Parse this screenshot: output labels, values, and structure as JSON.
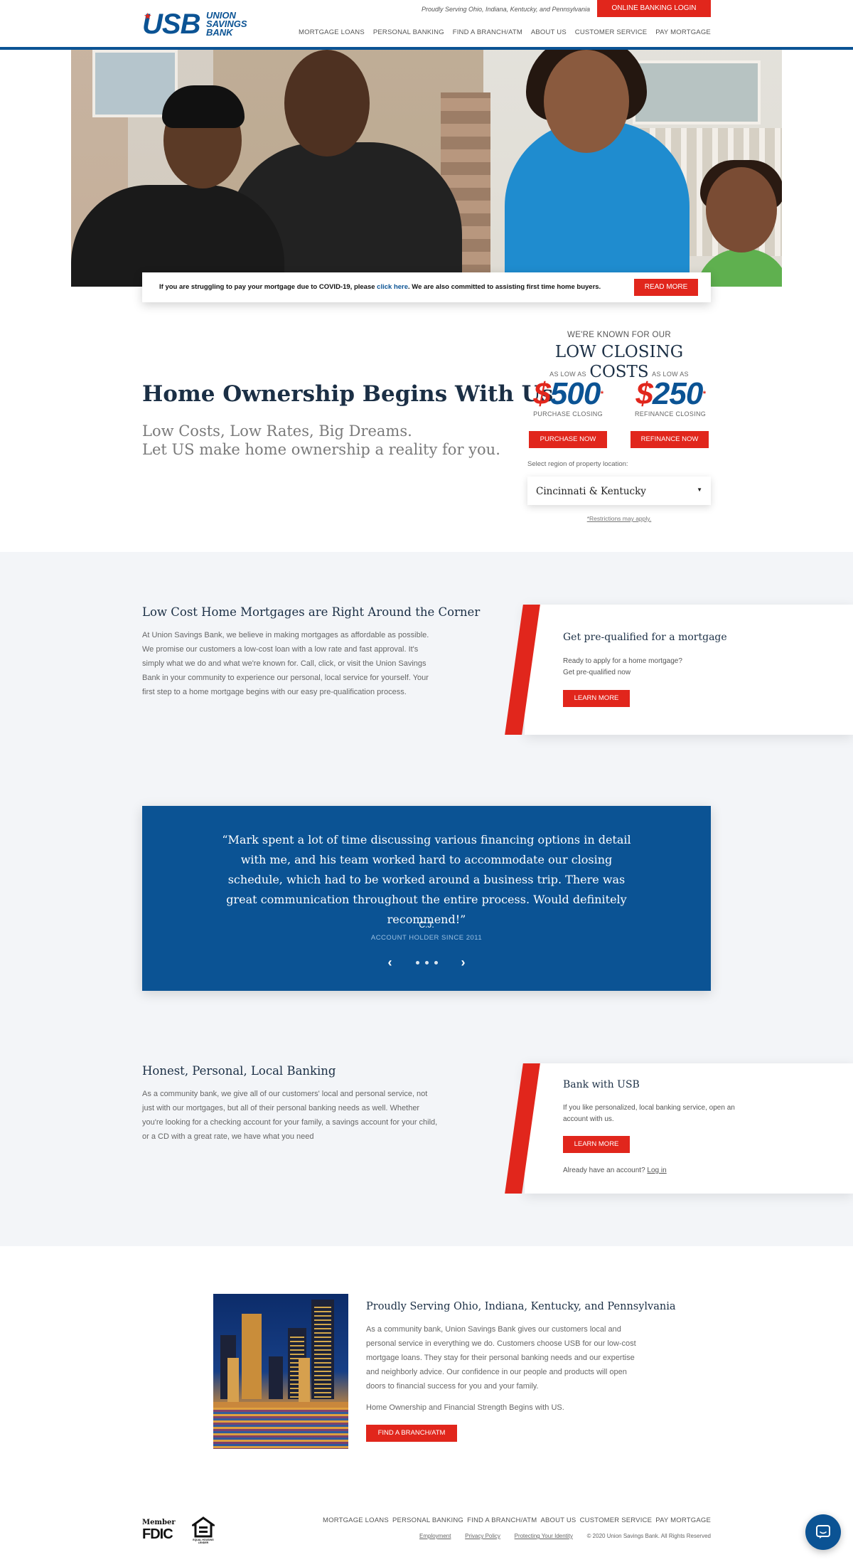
{
  "header": {
    "logo_mark": "USB",
    "logo_name": "UNION SAVINGS BANK",
    "proud_line": "Proudly Serving Ohio, Indiana, Kentucky, and Pennsylvania",
    "login_label": "ONLINE BANKING LOGIN",
    "nav": [
      "MORTGAGE LOANS",
      "PERSONAL BANKING",
      "FIND A BRANCH/ATM",
      "ABOUT US",
      "CUSTOMER SERVICE",
      "PAY MORTGAGE"
    ]
  },
  "covid": {
    "text_before": "If you are struggling to pay your mortgage due to COVID-19, please ",
    "link": "click here",
    "text_after": ". We are also committed to assisting first time home buyers.",
    "button": "READ MORE"
  },
  "intro": {
    "title": "Home Ownership Begins With Us",
    "sub_line1": "Low Costs, Low Rates, Big Dreams.",
    "sub_line2": "Let US make home ownership a reality for you."
  },
  "closing": {
    "known": "WE'RE KNOWN FOR OUR",
    "title": "LOW CLOSING COSTS",
    "purchase": {
      "as_low": "AS LOW AS",
      "dollar": "$",
      "amount": "500",
      "star": "*",
      "caption": "PURCHASE CLOSING",
      "button": "PURCHASE NOW"
    },
    "refinance": {
      "as_low": "AS LOW AS",
      "dollar": "$",
      "amount": "250",
      "star": "*",
      "caption": "REFINANCE CLOSING",
      "button": "REFINANCE NOW"
    },
    "region_label": "Select region of property location:",
    "region_value": "Cincinnati & Kentucky",
    "restrictions": "*Restrictions may apply."
  },
  "mortgage_block": {
    "title": "Low Cost Home Mortgages are Right Around the Corner",
    "body": "At Union Savings Bank, we believe in making mortgages as affordable as possible. We promise our customers a low-cost loan with a low rate and fast approval. It's simply what we do and what we're known for. Call, click, or visit the Union Savings Bank in your community to experience our personal, local service for yourself. Your first step to a home mortgage begins with our easy pre-qualification process."
  },
  "prequal_card": {
    "title": "Get pre-qualified for a mortgage",
    "line1": "Ready to apply for a home mortgage?",
    "line2": "Get pre-qualified now",
    "button": "LEARN MORE"
  },
  "testimonial": {
    "quote": "“Mark spent a lot of time discussing various financing options in detail with me, and his team worked hard to accommodate our closing schedule, which had to be worked around a business trip. There was great communication throughout the entire process. Would definitely recommend!”",
    "name": "C.J.",
    "since": "ACCOUNT HOLDER SINCE 2011",
    "prev": "‹",
    "next": "›"
  },
  "banking_block": {
    "title": "Honest, Personal, Local Banking",
    "body": "As a community bank, we give all of our customers' local and personal service, not just with our mortgages, but all of their personal banking needs as well. Whether you're looking for a checking account for your family, a savings account for your child, or a CD with a great rate, we have what you need"
  },
  "bank_card": {
    "title": "Bank with USB",
    "text": "If you like personalized, local banking service, open an account with us.",
    "button": "LEARN MORE",
    "foot": "Already have an account? ",
    "login": "Log in"
  },
  "serving": {
    "title": "Proudly Serving Ohio, Indiana, Kentucky, and Pennsylvania",
    "body": "As a community bank, Union Savings Bank gives our customers local and personal service in everything we do. Customers choose USB for our low-cost mortgage loans. They stay for their personal banking needs and our expertise and neighborly advice. Our confidence in our people and products will open doors to financial success for you and your family.",
    "tagline": "Home Ownership and Financial Strength Begins with US.",
    "button": "FIND A BRANCH/ATM"
  },
  "footer": {
    "fdic_member": "Member",
    "fdic": "FDIC",
    "ehl": "EQUAL HOUSING LENDER",
    "nav": [
      "MORTGAGE LOANS",
      "PERSONAL BANKING",
      "FIND A BRANCH/ATM",
      "ABOUT US",
      "CUSTOMER SERVICE",
      "PAY MORTGAGE"
    ],
    "links": [
      "Employment",
      "Privacy Policy",
      "Protecting Your Identity"
    ],
    "copyright": "© 2020 Union Savings Bank. All Rights Reserved"
  },
  "colors": {
    "brand_blue": "#0b5394",
    "brand_red": "#e1261c",
    "section_grey": "#f3f5f8"
  },
  "icons": {
    "chat": "chat-bubble-icon",
    "prev": "chevron-left-icon",
    "next": "chevron-right-icon",
    "caret": "caret-down-icon"
  }
}
